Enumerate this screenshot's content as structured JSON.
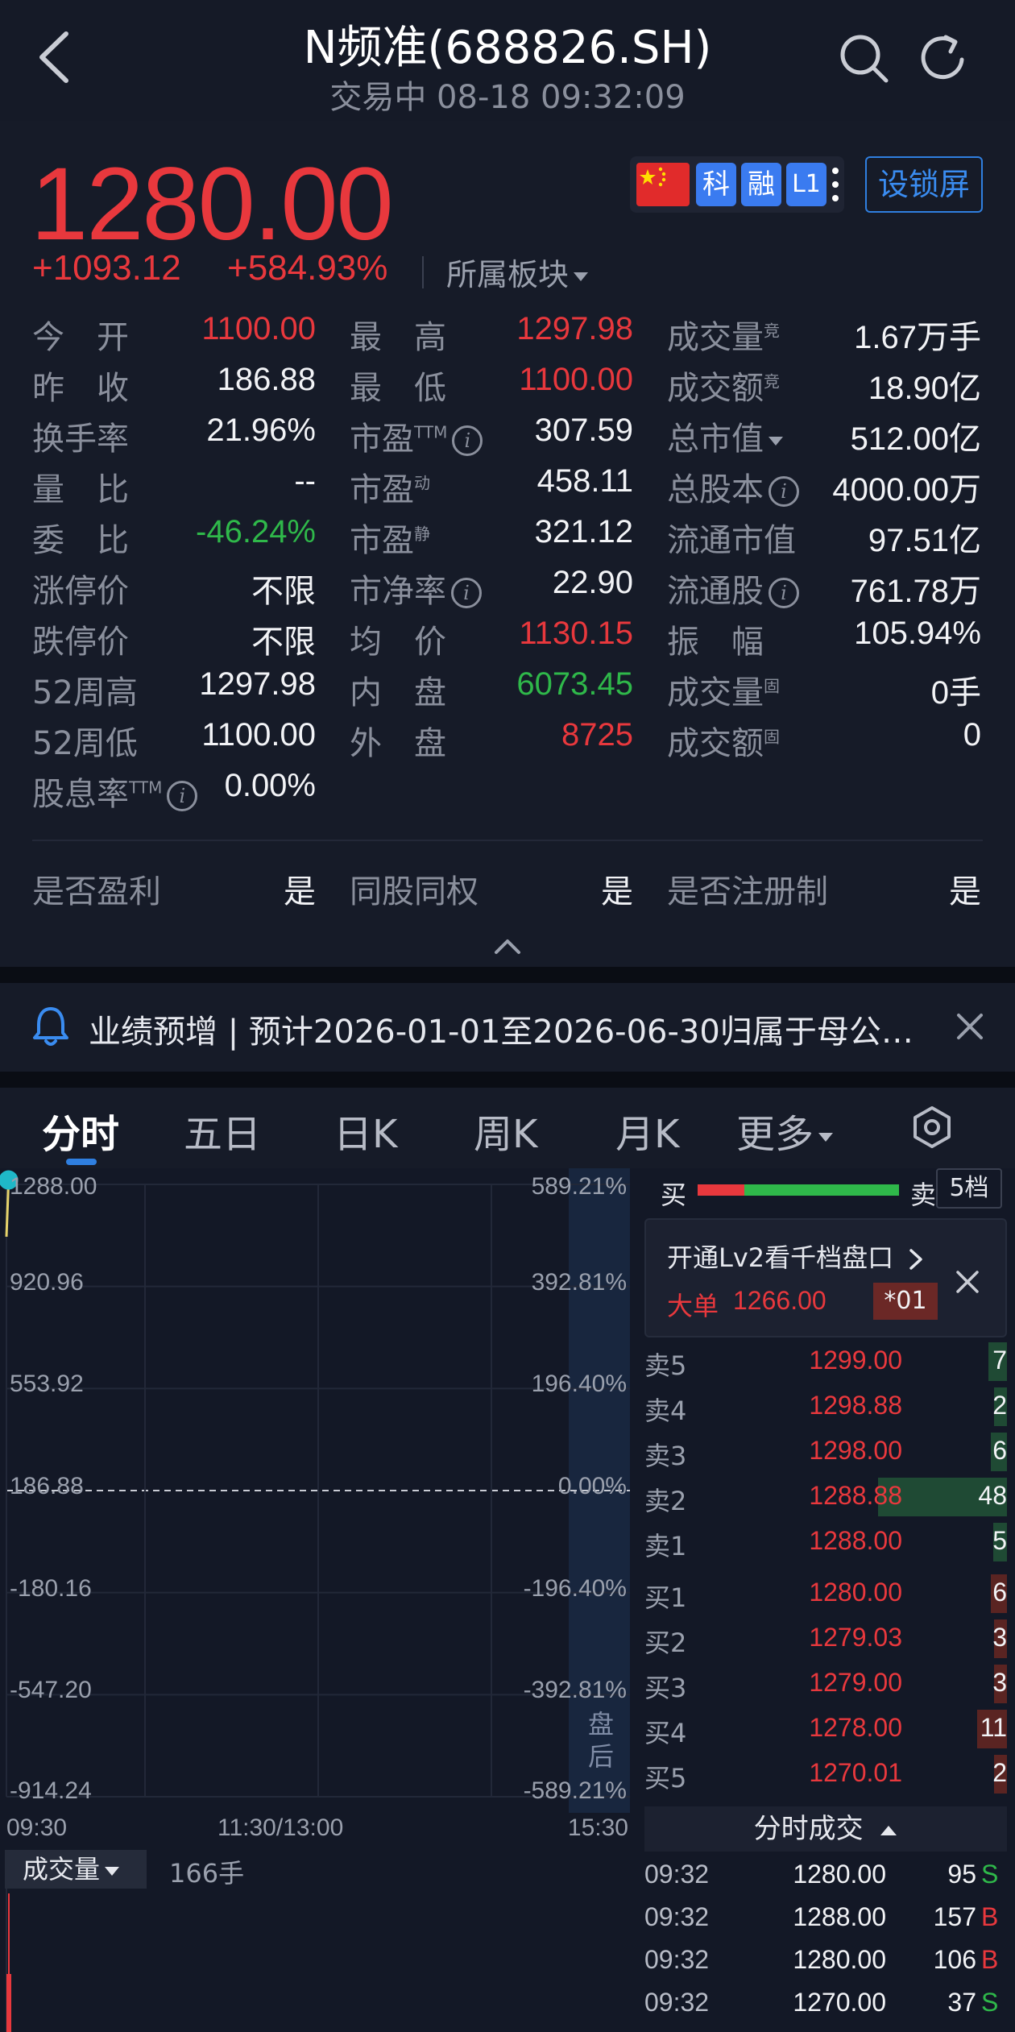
{
  "header": {
    "title": "N频准(688826.SH)",
    "subtitle": "交易中 08-18 09:32:09"
  },
  "quote": {
    "price": "1280.00",
    "change_abs": "+1093.12",
    "change_pct": "+584.93%",
    "sector_label": "所属板块",
    "badges": {
      "ke": "科",
      "rong": "融",
      "l1": "L1"
    },
    "lock_label": "设锁屏",
    "stats": [
      {
        "label": "今　开",
        "value": "1100.00",
        "color": "red"
      },
      {
        "label": "最　高",
        "value": "1297.98",
        "color": "red"
      },
      {
        "label": "成交量",
        "sup": "竞",
        "value": "1.67万手",
        "color": "white"
      },
      {
        "label": "昨　收",
        "value": "186.88",
        "color": "white"
      },
      {
        "label": "最　低",
        "value": "1100.00",
        "color": "red"
      },
      {
        "label": "成交额",
        "sup": "竞",
        "value": "18.90亿",
        "color": "white"
      },
      {
        "label": "换手率",
        "value": "21.96%",
        "color": "white"
      },
      {
        "label": "市盈",
        "sup": "TTM",
        "info": true,
        "value": "307.59",
        "color": "white"
      },
      {
        "label": "总市值",
        "caret": true,
        "value": "512.00亿",
        "color": "white"
      },
      {
        "label": "量　比",
        "value": "--",
        "color": "white"
      },
      {
        "label": "市盈",
        "sup": "动",
        "value": "458.11",
        "color": "white"
      },
      {
        "label": "总股本",
        "info": true,
        "value": "4000.00万",
        "color": "white"
      },
      {
        "label": "委　比",
        "value": "-46.24%",
        "color": "green"
      },
      {
        "label": "市盈",
        "sup": "静",
        "value": "321.12",
        "color": "white"
      },
      {
        "label": "流通市值",
        "value": "97.51亿",
        "color": "white"
      },
      {
        "label": "涨停价",
        "value": "不限",
        "color": "white"
      },
      {
        "label": "市净率",
        "info": true,
        "value": "22.90",
        "color": "white"
      },
      {
        "label": "流通股",
        "info": true,
        "value": "761.78万",
        "color": "white"
      },
      {
        "label": "跌停价",
        "value": "不限",
        "color": "white"
      },
      {
        "label": "均　价",
        "value": "1130.15",
        "color": "red"
      },
      {
        "label": "振　幅",
        "value": "105.94%",
        "color": "white"
      },
      {
        "label": "52周高",
        "value": "1297.98",
        "color": "white"
      },
      {
        "label": "内　盘",
        "value": "6073.45",
        "color": "green"
      },
      {
        "label": "成交量",
        "sup": "固",
        "value": "0手",
        "color": "white"
      },
      {
        "label": "52周低",
        "value": "1100.00",
        "color": "white"
      },
      {
        "label": "外　盘",
        "value": "8725",
        "color": "red"
      },
      {
        "label": "成交额",
        "sup": "固",
        "value": "0",
        "color": "white"
      },
      {
        "label": "股息率",
        "sup": "TTM",
        "info": true,
        "value": "0.00%",
        "color": "white"
      }
    ],
    "flags": [
      {
        "label": "是否盈利",
        "value": "是"
      },
      {
        "label": "同股同权",
        "value": "是"
      },
      {
        "label": "是否注册制",
        "value": "是"
      }
    ]
  },
  "notice": {
    "text": "业绩预增 | 预计2026-01-01至2026-06-30归属于母公…"
  },
  "tabs": [
    "分时",
    "五日",
    "日K",
    "周K",
    "月K",
    "更多"
  ],
  "chart": {
    "left_axis": [
      "1288.00",
      "920.96",
      "553.92",
      "186.88",
      "-180.16",
      "-547.20",
      "-914.24"
    ],
    "right_axis": [
      "589.21%",
      "392.81%",
      "196.40%",
      "0.00%",
      "-196.40%",
      "-392.81%",
      "-589.21%"
    ],
    "time_axis": [
      "09:30",
      "11:30/13:00",
      "15:30"
    ],
    "after_hours_label": "盘后",
    "volume_label": "成交量",
    "volume_value": "166手"
  },
  "chart_data": {
    "type": "line",
    "x": [
      "09:30",
      "09:31",
      "09:32"
    ],
    "series": [
      {
        "values": [
          1100.0,
          1297.98,
          1280.0
        ]
      }
    ],
    "ylim": [
      -914.24,
      1288.0
    ],
    "baseline": 186.88
  },
  "book": {
    "buy_label": "买",
    "sell_label": "卖",
    "levels_label": "5档",
    "lv2_text": "开通Lv2看千档盘口",
    "bigorder_label": "大单",
    "bigorder_price": "1266.00",
    "bigorder_tag": "*01",
    "asks": [
      {
        "label": "卖5",
        "price": "1299.00",
        "vol": "7",
        "ratio": 0.146
      },
      {
        "label": "卖4",
        "price": "1298.88",
        "vol": "2",
        "ratio": 0.042
      },
      {
        "label": "卖3",
        "price": "1298.00",
        "vol": "6",
        "ratio": 0.125
      },
      {
        "label": "卖2",
        "price": "1288.88",
        "vol": "48",
        "ratio": 1.0
      },
      {
        "label": "卖1",
        "price": "1288.00",
        "vol": "5",
        "ratio": 0.104
      }
    ],
    "bids": [
      {
        "label": "买1",
        "price": "1280.00",
        "vol": "6",
        "ratio": 0.125
      },
      {
        "label": "买2",
        "price": "1279.03",
        "vol": "3",
        "ratio": 0.063
      },
      {
        "label": "买3",
        "price": "1279.00",
        "vol": "3",
        "ratio": 0.063
      },
      {
        "label": "买4",
        "price": "1278.00",
        "vol": "11",
        "ratio": 0.229
      },
      {
        "label": "买5",
        "price": "1270.01",
        "vol": "2",
        "ratio": 0.042
      }
    ],
    "ticks_header": "分时成交",
    "ticks": [
      {
        "time": "09:32",
        "price": "1280.00",
        "vol": "95",
        "side": "S"
      },
      {
        "time": "09:32",
        "price": "1288.00",
        "vol": "157",
        "side": "B"
      },
      {
        "time": "09:32",
        "price": "1280.00",
        "vol": "106",
        "side": "B"
      },
      {
        "time": "09:32",
        "price": "1270.00",
        "vol": "37",
        "side": "S"
      }
    ]
  },
  "colors": {
    "up": "#e8383d",
    "down": "#2fb84a",
    "accent": "#2f7fe0",
    "background": "#151a27"
  }
}
